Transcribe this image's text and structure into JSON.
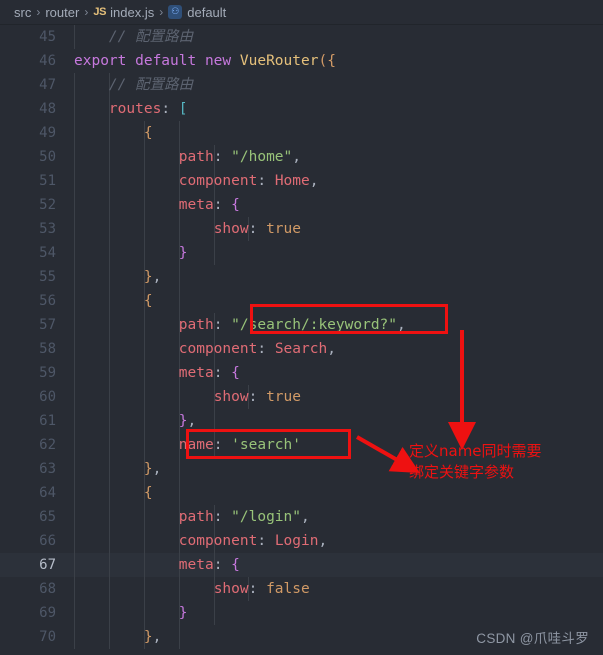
{
  "breadcrumb": {
    "name": "breadcrumb",
    "items": [
      {
        "label": "src",
        "icon": null
      },
      {
        "label": "router",
        "icon": null
      },
      {
        "label": "index.js",
        "icon": "js-file-icon",
        "icon_text": "JS"
      },
      {
        "label": "default",
        "icon": "symbol-default-icon",
        "icon_text": "⚇"
      }
    ],
    "separator": "›"
  },
  "editor": {
    "first_line": 45,
    "active_line": 67,
    "lines": [
      {
        "n": 45,
        "guides": [
          0
        ],
        "tokens": [
          {
            "t": "    ",
            "c": "c-punct"
          },
          {
            "t": "// 配置路由",
            "c": "c-comment"
          }
        ]
      },
      {
        "n": 46,
        "guides": [],
        "tokens": [
          {
            "t": "export ",
            "c": "c-keyword"
          },
          {
            "t": "default ",
            "c": "c-keyword"
          },
          {
            "t": "new ",
            "c": "c-keyword"
          },
          {
            "t": "VueRouter",
            "c": "c-class"
          },
          {
            "t": "(",
            "c": "c-br-y"
          },
          {
            "t": "{",
            "c": "c-br-y"
          }
        ]
      },
      {
        "n": 47,
        "guides": [
          0,
          1
        ],
        "tokens": [
          {
            "t": "    ",
            "c": "c-punct"
          },
          {
            "t": "// 配置路由",
            "c": "c-comment"
          }
        ]
      },
      {
        "n": 48,
        "guides": [
          0,
          1
        ],
        "tokens": [
          {
            "t": "    ",
            "c": "c-punct"
          },
          {
            "t": "routes",
            "c": "c-prop"
          },
          {
            "t": ": ",
            "c": "c-punct"
          },
          {
            "t": "[",
            "c": "c-br-b"
          }
        ]
      },
      {
        "n": 49,
        "guides": [
          0,
          1,
          2,
          3
        ],
        "tokens": [
          {
            "t": "        ",
            "c": "c-punct"
          },
          {
            "t": "{",
            "c": "c-br-y"
          }
        ]
      },
      {
        "n": 50,
        "guides": [
          0,
          1,
          2,
          3,
          4
        ],
        "tokens": [
          {
            "t": "            ",
            "c": "c-punct"
          },
          {
            "t": "path",
            "c": "c-prop"
          },
          {
            "t": ": ",
            "c": "c-punct"
          },
          {
            "t": "\"/home\"",
            "c": "c-string"
          },
          {
            "t": ",",
            "c": "c-punct"
          }
        ]
      },
      {
        "n": 51,
        "guides": [
          0,
          1,
          2,
          3,
          4
        ],
        "tokens": [
          {
            "t": "            ",
            "c": "c-punct"
          },
          {
            "t": "component",
            "c": "c-prop"
          },
          {
            "t": ": ",
            "c": "c-punct"
          },
          {
            "t": "Home",
            "c": "c-prop"
          },
          {
            "t": ",",
            "c": "c-punct"
          }
        ]
      },
      {
        "n": 52,
        "guides": [
          0,
          1,
          2,
          3,
          4
        ],
        "tokens": [
          {
            "t": "            ",
            "c": "c-punct"
          },
          {
            "t": "meta",
            "c": "c-prop"
          },
          {
            "t": ": ",
            "c": "c-punct"
          },
          {
            "t": "{",
            "c": "c-br-p"
          }
        ]
      },
      {
        "n": 53,
        "guides": [
          0,
          1,
          2,
          3,
          4,
          5
        ],
        "tokens": [
          {
            "t": "                ",
            "c": "c-punct"
          },
          {
            "t": "show",
            "c": "c-prop"
          },
          {
            "t": ": ",
            "c": "c-punct"
          },
          {
            "t": "true",
            "c": "c-const"
          }
        ]
      },
      {
        "n": 54,
        "guides": [
          0,
          1,
          2,
          3,
          4
        ],
        "tokens": [
          {
            "t": "            ",
            "c": "c-punct"
          },
          {
            "t": "}",
            "c": "c-br-p"
          }
        ]
      },
      {
        "n": 55,
        "guides": [
          0,
          1,
          2,
          3
        ],
        "tokens": [
          {
            "t": "        ",
            "c": "c-punct"
          },
          {
            "t": "}",
            "c": "c-br-y"
          },
          {
            "t": ",",
            "c": "c-punct"
          }
        ]
      },
      {
        "n": 56,
        "guides": [
          0,
          1,
          2,
          3
        ],
        "tokens": [
          {
            "t": "        ",
            "c": "c-punct"
          },
          {
            "t": "{",
            "c": "c-br-y"
          }
        ]
      },
      {
        "n": 57,
        "guides": [
          0,
          1,
          2,
          3,
          4
        ],
        "tokens": [
          {
            "t": "            ",
            "c": "c-punct"
          },
          {
            "t": "path",
            "c": "c-prop"
          },
          {
            "t": ": ",
            "c": "c-punct"
          },
          {
            "t": "\"/search/:keyword?\"",
            "c": "c-string"
          },
          {
            "t": ",",
            "c": "c-punct"
          }
        ]
      },
      {
        "n": 58,
        "guides": [
          0,
          1,
          2,
          3,
          4
        ],
        "tokens": [
          {
            "t": "            ",
            "c": "c-punct"
          },
          {
            "t": "component",
            "c": "c-prop"
          },
          {
            "t": ": ",
            "c": "c-punct"
          },
          {
            "t": "Search",
            "c": "c-prop"
          },
          {
            "t": ",",
            "c": "c-punct"
          }
        ]
      },
      {
        "n": 59,
        "guides": [
          0,
          1,
          2,
          3,
          4
        ],
        "tokens": [
          {
            "t": "            ",
            "c": "c-punct"
          },
          {
            "t": "meta",
            "c": "c-prop"
          },
          {
            "t": ": ",
            "c": "c-punct"
          },
          {
            "t": "{",
            "c": "c-br-p"
          }
        ]
      },
      {
        "n": 60,
        "guides": [
          0,
          1,
          2,
          3,
          4,
          5
        ],
        "tokens": [
          {
            "t": "                ",
            "c": "c-punct"
          },
          {
            "t": "show",
            "c": "c-prop"
          },
          {
            "t": ": ",
            "c": "c-punct"
          },
          {
            "t": "true",
            "c": "c-const"
          }
        ]
      },
      {
        "n": 61,
        "guides": [
          0,
          1,
          2,
          3,
          4
        ],
        "tokens": [
          {
            "t": "            ",
            "c": "c-punct"
          },
          {
            "t": "}",
            "c": "c-br-p"
          },
          {
            "t": ",",
            "c": "c-punct"
          }
        ]
      },
      {
        "n": 62,
        "guides": [
          0,
          1,
          2,
          3,
          4
        ],
        "tokens": [
          {
            "t": "            ",
            "c": "c-punct"
          },
          {
            "t": "name",
            "c": "c-prop"
          },
          {
            "t": ": ",
            "c": "c-punct"
          },
          {
            "t": "'search'",
            "c": "c-string"
          }
        ]
      },
      {
        "n": 63,
        "guides": [
          0,
          1,
          2,
          3
        ],
        "tokens": [
          {
            "t": "        ",
            "c": "c-punct"
          },
          {
            "t": "}",
            "c": "c-br-y"
          },
          {
            "t": ",",
            "c": "c-punct"
          }
        ]
      },
      {
        "n": 64,
        "guides": [
          0,
          1,
          2,
          3
        ],
        "tokens": [
          {
            "t": "        ",
            "c": "c-punct"
          },
          {
            "t": "{",
            "c": "c-br-y"
          }
        ]
      },
      {
        "n": 65,
        "guides": [
          0,
          1,
          2,
          3,
          4
        ],
        "tokens": [
          {
            "t": "            ",
            "c": "c-punct"
          },
          {
            "t": "path",
            "c": "c-prop"
          },
          {
            "t": ": ",
            "c": "c-punct"
          },
          {
            "t": "\"/login\"",
            "c": "c-string"
          },
          {
            "t": ",",
            "c": "c-punct"
          }
        ]
      },
      {
        "n": 66,
        "guides": [
          0,
          1,
          2,
          3,
          4
        ],
        "tokens": [
          {
            "t": "            ",
            "c": "c-punct"
          },
          {
            "t": "component",
            "c": "c-prop"
          },
          {
            "t": ": ",
            "c": "c-punct"
          },
          {
            "t": "Login",
            "c": "c-prop"
          },
          {
            "t": ",",
            "c": "c-punct"
          }
        ]
      },
      {
        "n": 67,
        "guides": [
          0,
          1,
          2,
          3,
          4
        ],
        "tokens": [
          {
            "t": "            ",
            "c": "c-punct"
          },
          {
            "t": "meta",
            "c": "c-prop"
          },
          {
            "t": ": ",
            "c": "c-punct"
          },
          {
            "t": "{",
            "c": "c-br-p"
          }
        ]
      },
      {
        "n": 68,
        "guides": [
          0,
          1,
          2,
          3,
          4,
          5
        ],
        "tokens": [
          {
            "t": "                ",
            "c": "c-punct"
          },
          {
            "t": "show",
            "c": "c-prop"
          },
          {
            "t": ": ",
            "c": "c-punct"
          },
          {
            "t": "false",
            "c": "c-const"
          }
        ]
      },
      {
        "n": 69,
        "guides": [
          0,
          1,
          2,
          3,
          4
        ],
        "tokens": [
          {
            "t": "            ",
            "c": "c-punct"
          },
          {
            "t": "}",
            "c": "c-br-p"
          }
        ]
      },
      {
        "n": 70,
        "guides": [
          0,
          1,
          2,
          3
        ],
        "tokens": [
          {
            "t": "        ",
            "c": "c-punct"
          },
          {
            "t": "}",
            "c": "c-br-y"
          },
          {
            "t": ",",
            "c": "c-punct"
          }
        ]
      }
    ]
  },
  "annotations": {
    "highlight_color": "#ee1111",
    "boxes": [
      {
        "name": "search-path-highlight-box",
        "target": "\"/search/:keyword?\""
      },
      {
        "name": "search-name-highlight-box",
        "target": "name: 'search'"
      }
    ],
    "note_lines": [
      "定义name同时需要",
      "绑定关键字参数"
    ]
  },
  "watermark": "CSDN @爪哇斗罗"
}
